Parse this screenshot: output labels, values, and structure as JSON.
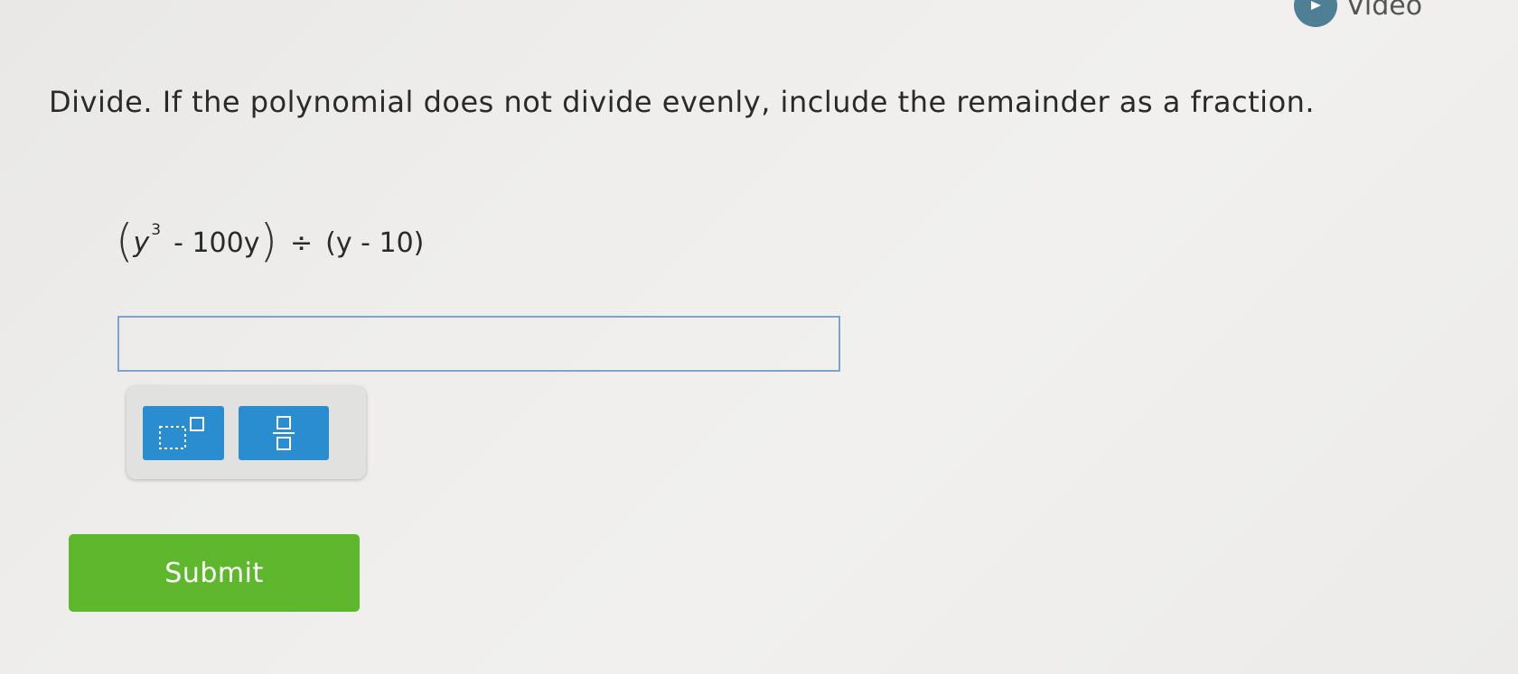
{
  "header": {
    "video_label": "Video"
  },
  "question": {
    "prompt": "Divide. If the polynomial does not divide evenly, include the remainder as a fraction.",
    "expression": {
      "dividend_base": "y",
      "dividend_exponent": "3",
      "dividend_rest": "- 100y",
      "divide_sign": "÷",
      "divisor": "(y - 10)"
    }
  },
  "answer": {
    "value": "",
    "placeholder": ""
  },
  "toolbar": {
    "buttons": [
      {
        "name": "exponent-template",
        "icon": "superscript-box-icon"
      },
      {
        "name": "fraction-template",
        "icon": "fraction-box-icon"
      }
    ]
  },
  "actions": {
    "submit_label": "Submit"
  },
  "colors": {
    "toolbar_button": "#2a8dd0",
    "submit": "#5fb72e",
    "input_border": "#7fa3cc",
    "video_button": "#4e7f94"
  }
}
